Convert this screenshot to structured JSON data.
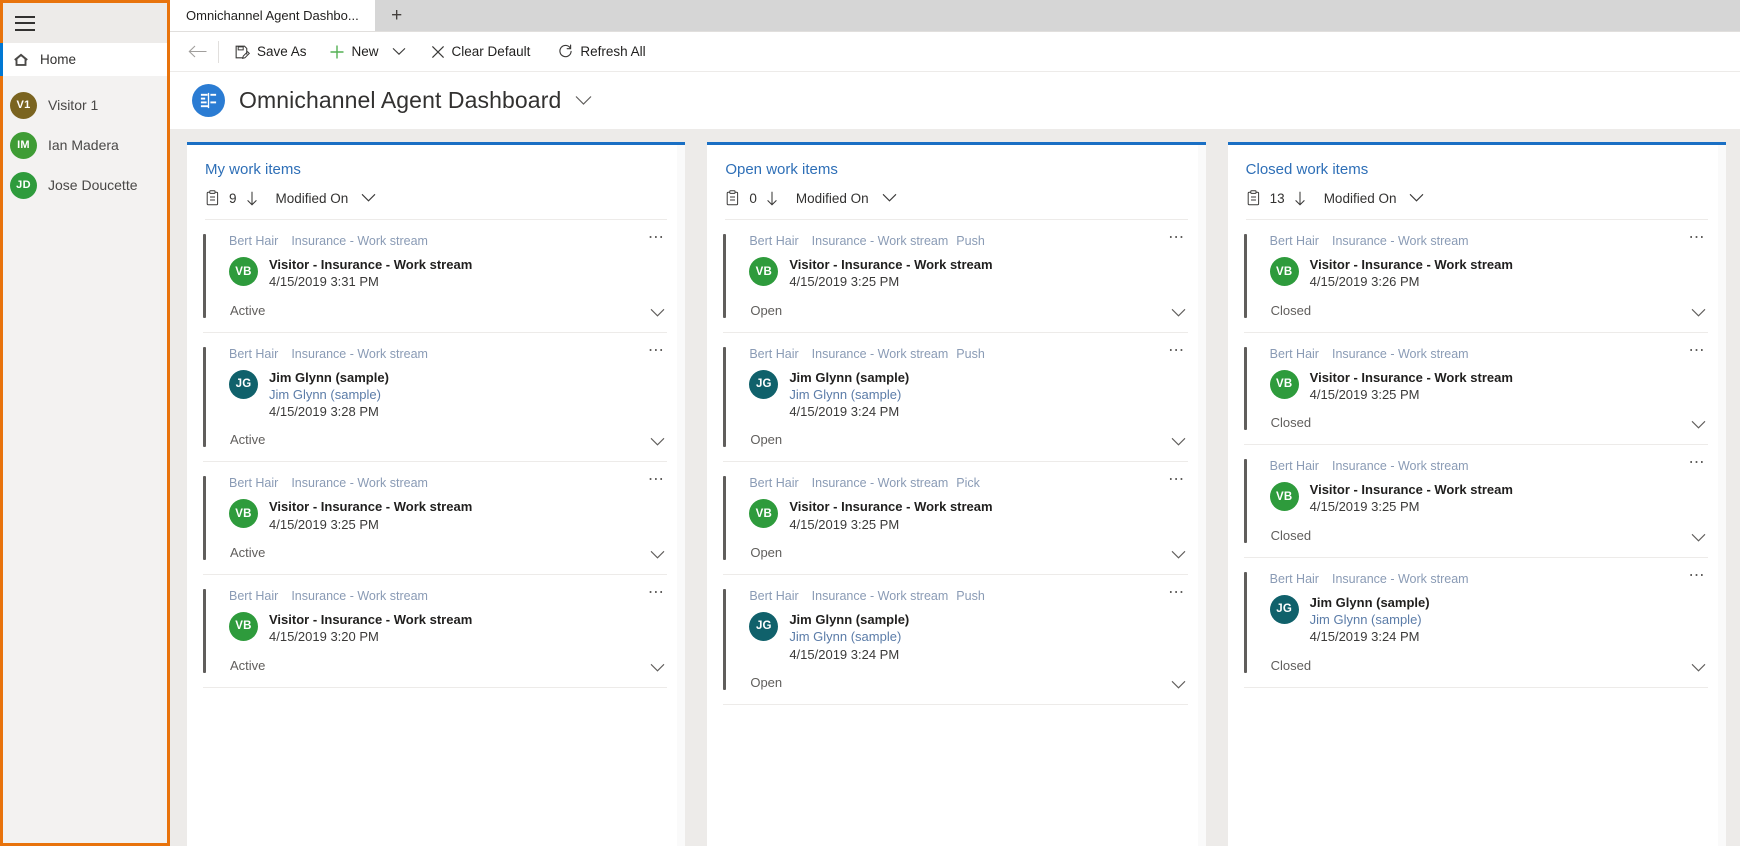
{
  "sidebar": {
    "menu_icon": "hamburger-icon",
    "home": {
      "label": "Home",
      "icon": "home-icon"
    },
    "people": [
      {
        "initials": "V1",
        "name": "Visitor 1",
        "color": "#7a6420"
      },
      {
        "initials": "IM",
        "name": "Ian Madera",
        "color": "#3e9c35"
      },
      {
        "initials": "JD",
        "name": "Jose Doucette",
        "color": "#2e9b3c"
      }
    ],
    "highlight_color": "#e8730c"
  },
  "tabstrip": {
    "tabs": [
      {
        "label": "Omnichannel Agent Dashbo..."
      }
    ],
    "new_tab_label": "+"
  },
  "commandbar": {
    "back_label": "←",
    "save_as": "Save As",
    "new": "New",
    "clear_default": "Clear Default",
    "refresh_all": "Refresh All"
  },
  "page": {
    "title": "Omnichannel Agent Dashboard",
    "icon": "dashboard-icon",
    "accent_color": "#2b7cd3"
  },
  "columns": [
    {
      "title": "My work items",
      "count": "9",
      "sort_label": "Modified On",
      "cards": [
        {
          "person": "Bert Hair",
          "stream": "Insurance - Work stream",
          "mode": "",
          "initials": "VB",
          "avatar_color": "#2e9b3c",
          "title": "Visitor - Insurance - Work stream",
          "sub": "",
          "date": "4/15/2019 3:31 PM",
          "status": "Active"
        },
        {
          "person": "Bert Hair",
          "stream": "Insurance - Work stream",
          "mode": "",
          "initials": "JG",
          "avatar_color": "#10616b",
          "title": "Jim Glynn (sample)",
          "sub": "Jim Glynn (sample)",
          "date": "4/15/2019 3:28 PM",
          "status": "Active"
        },
        {
          "person": "Bert Hair",
          "stream": "Insurance - Work stream",
          "mode": "",
          "initials": "VB",
          "avatar_color": "#2e9b3c",
          "title": "Visitor - Insurance - Work stream",
          "sub": "",
          "date": "4/15/2019 3:25 PM",
          "status": "Active"
        },
        {
          "person": "Bert Hair",
          "stream": "Insurance - Work stream",
          "mode": "",
          "initials": "VB",
          "avatar_color": "#2e9b3c",
          "title": "Visitor - Insurance - Work stream",
          "sub": "",
          "date": "4/15/2019 3:20 PM",
          "status": "Active"
        }
      ]
    },
    {
      "title": "Open work items",
      "count": "0",
      "sort_label": "Modified On",
      "cards": [
        {
          "person": "Bert Hair",
          "stream": "Insurance - Work stream",
          "mode": "Push",
          "initials": "VB",
          "avatar_color": "#2e9b3c",
          "title": "Visitor - Insurance - Work stream",
          "sub": "",
          "date": "4/15/2019 3:25 PM",
          "status": "Open"
        },
        {
          "person": "Bert Hair",
          "stream": "Insurance - Work stream",
          "mode": "Push",
          "initials": "JG",
          "avatar_color": "#10616b",
          "title": "Jim Glynn (sample)",
          "sub": "Jim Glynn (sample)",
          "date": "4/15/2019 3:24 PM",
          "status": "Open"
        },
        {
          "person": "Bert Hair",
          "stream": "Insurance - Work stream",
          "mode": "Pick",
          "initials": "VB",
          "avatar_color": "#2e9b3c",
          "title": "Visitor - Insurance - Work stream",
          "sub": "",
          "date": "4/15/2019 3:25 PM",
          "status": "Open"
        },
        {
          "person": "Bert Hair",
          "stream": "Insurance - Work stream",
          "mode": "Push",
          "initials": "JG",
          "avatar_color": "#10616b",
          "title": "Jim Glynn (sample)",
          "sub": "Jim Glynn (sample)",
          "date": "4/15/2019 3:24 PM",
          "status": "Open"
        }
      ]
    },
    {
      "title": "Closed work items",
      "count": "13",
      "sort_label": "Modified On",
      "cards": [
        {
          "person": "Bert Hair",
          "stream": "Insurance - Work stream",
          "mode": "",
          "initials": "VB",
          "avatar_color": "#2e9b3c",
          "title": "Visitor - Insurance - Work stream",
          "sub": "",
          "date": "4/15/2019 3:26 PM",
          "status": "Closed"
        },
        {
          "person": "Bert Hair",
          "stream": "Insurance - Work stream",
          "mode": "",
          "initials": "VB",
          "avatar_color": "#2e9b3c",
          "title": "Visitor - Insurance - Work stream",
          "sub": "",
          "date": "4/15/2019 3:25 PM",
          "status": "Closed"
        },
        {
          "person": "Bert Hair",
          "stream": "Insurance - Work stream",
          "mode": "",
          "initials": "VB",
          "avatar_color": "#2e9b3c",
          "title": "Visitor - Insurance - Work stream",
          "sub": "",
          "date": "4/15/2019 3:25 PM",
          "status": "Closed"
        },
        {
          "person": "Bert Hair",
          "stream": "Insurance - Work stream",
          "mode": "",
          "initials": "JG",
          "avatar_color": "#10616b",
          "title": "Jim Glynn (sample)",
          "sub": "Jim Glynn (sample)",
          "date": "4/15/2019 3:24 PM",
          "status": "Closed"
        }
      ]
    }
  ]
}
